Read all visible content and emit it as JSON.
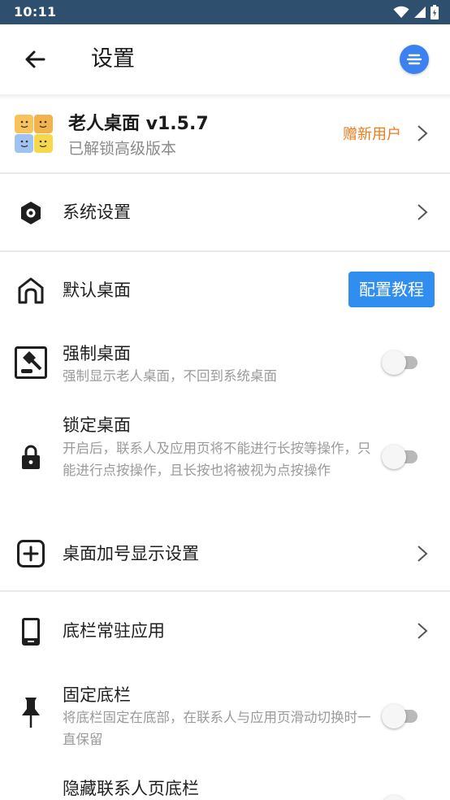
{
  "status_bar": {
    "time": "10:11",
    "icons": [
      "wifi-icon",
      "signal-icon",
      "battery-icon"
    ]
  },
  "app_bar": {
    "title": "设置",
    "back_icon": "arrow-left-icon",
    "menu_icon": "menu-lines-icon"
  },
  "app_card": {
    "name": "老人桌面 v1.5.7",
    "status": "已解锁高级版本",
    "promo": "赠新用户",
    "promo_color": "#ef7b1a"
  },
  "settings": {
    "system": {
      "label": "系统设置"
    },
    "default_launcher": {
      "label": "默认桌面",
      "button": "配置教程"
    },
    "force_launcher": {
      "label": "强制桌面",
      "desc": "强制显示老人桌面，不回到系统桌面",
      "enabled": false
    },
    "lock_launcher": {
      "label": "锁定桌面",
      "desc": "开启后，联系人及应用页将不能进行长按等操作，只能进行点按操作，且长按也将被视为点按操作",
      "enabled": false
    },
    "plus_display": {
      "label": "桌面加号显示设置"
    },
    "dock_apps": {
      "label": "底栏常驻应用"
    },
    "fix_dock": {
      "label": "固定底栏",
      "desc": "将底栏固定在底部，在联系人与应用页滑动切换时一直保留",
      "enabled": false
    },
    "hide_contact_dock": {
      "label": "隐藏联系人页底栏"
    }
  },
  "colors": {
    "status_bar": "#2f4f6f",
    "accent_blue": "#2f8ef0",
    "promo_orange": "#ef7b1a"
  }
}
